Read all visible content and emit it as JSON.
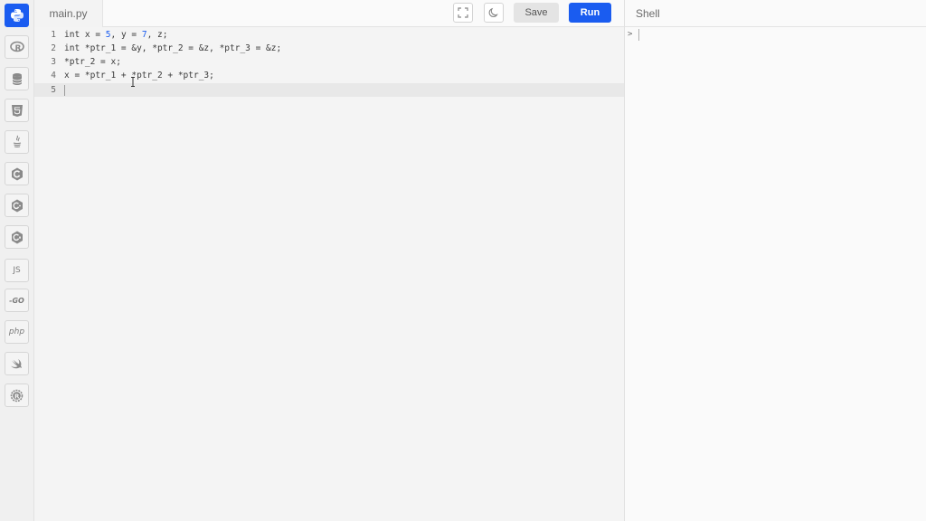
{
  "sidebar": {
    "languages": [
      {
        "id": "python",
        "icon": "python-icon",
        "active": true
      },
      {
        "id": "r",
        "icon": "r-icon",
        "active": false
      },
      {
        "id": "sql",
        "icon": "database-icon",
        "active": false
      },
      {
        "id": "html",
        "icon": "html5-icon",
        "active": false
      },
      {
        "id": "java",
        "icon": "java-icon",
        "active": false
      },
      {
        "id": "c",
        "icon": "c-icon",
        "active": false
      },
      {
        "id": "cpp",
        "icon": "cpp-icon",
        "active": false
      },
      {
        "id": "csharp",
        "icon": "csharp-icon",
        "active": false
      },
      {
        "id": "js",
        "icon": "javascript-icon",
        "label": "JS",
        "active": false
      },
      {
        "id": "go",
        "icon": "go-icon",
        "label": "-GO",
        "active": false
      },
      {
        "id": "php",
        "icon": "php-icon",
        "label": "php",
        "active": false
      },
      {
        "id": "swift",
        "icon": "swift-icon",
        "active": false
      },
      {
        "id": "rust",
        "icon": "rust-icon",
        "active": false
      }
    ]
  },
  "toolbar": {
    "file_tab": "main.py",
    "fullscreen_icon": "fullscreen-icon",
    "theme_icon": "moon-icon",
    "save_label": "Save",
    "run_label": "Run"
  },
  "editor": {
    "current_line": 5,
    "lines": [
      {
        "num": "1",
        "parts": [
          {
            "t": "int x = "
          },
          {
            "t": "5",
            "n": true
          },
          {
            "t": ", y = "
          },
          {
            "t": "7",
            "n": true
          },
          {
            "t": ", z;"
          }
        ]
      },
      {
        "num": "2",
        "parts": [
          {
            "t": "int *ptr_1 = &y, *ptr_2 = &z, *ptr_3 = &z;"
          }
        ]
      },
      {
        "num": "3",
        "parts": [
          {
            "t": "*ptr_2 = x;"
          }
        ]
      },
      {
        "num": "4",
        "parts": [
          {
            "t": "x = *ptr_1 + *ptr_2 + *ptr_3;"
          }
        ]
      },
      {
        "num": "5",
        "parts": []
      }
    ]
  },
  "shell": {
    "title": "Shell",
    "prompt": ">"
  },
  "colors": {
    "accent": "#1a5cf0",
    "number": "#1a5cf0"
  }
}
